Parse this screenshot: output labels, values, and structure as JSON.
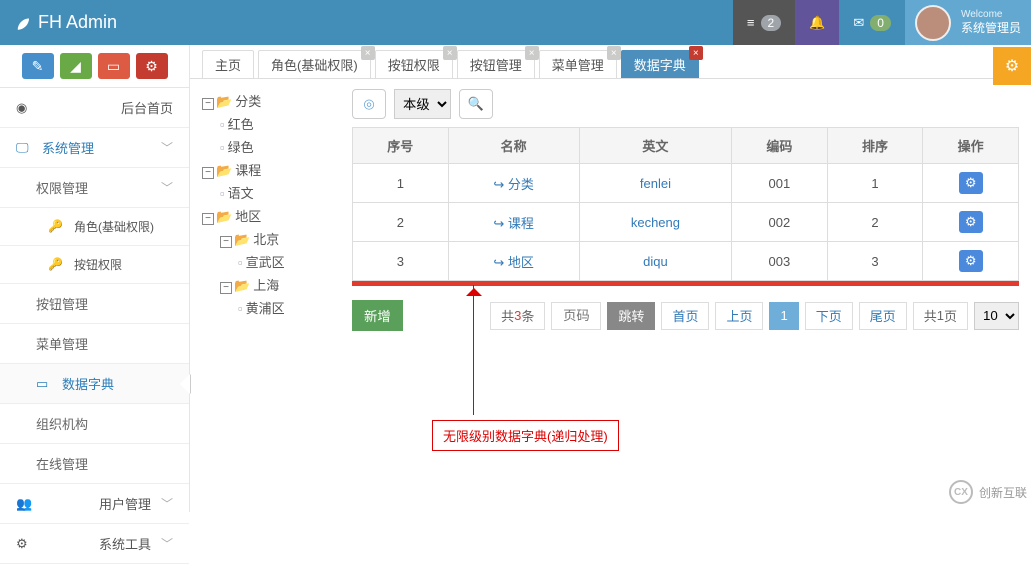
{
  "header": {
    "brand": "FH Admin",
    "tasks_badge": "2",
    "mail_badge": "0",
    "welcome": "Welcome",
    "username": "系统管理员"
  },
  "mini_buttons": [
    "pencil",
    "chart",
    "book",
    "gear"
  ],
  "sidebar": {
    "items": [
      {
        "label": "后台首页"
      },
      {
        "label": "系统管理"
      },
      {
        "label": "权限管理"
      },
      {
        "label": "角色(基础权限)"
      },
      {
        "label": "按钮权限"
      },
      {
        "label": "按钮管理"
      },
      {
        "label": "菜单管理"
      },
      {
        "label": "数据字典"
      },
      {
        "label": "组织机构"
      },
      {
        "label": "在线管理"
      },
      {
        "label": "用户管理"
      },
      {
        "label": "系统工具"
      }
    ]
  },
  "tabs": [
    {
      "label": "主页",
      "closable": false
    },
    {
      "label": "角色(基础权限)",
      "closable": true
    },
    {
      "label": "按钮权限",
      "closable": true
    },
    {
      "label": "按钮管理",
      "closable": true
    },
    {
      "label": "菜单管理",
      "closable": true
    },
    {
      "label": "数据字典",
      "closable": true,
      "active": true
    }
  ],
  "tree": [
    {
      "d": 0,
      "t": "minus",
      "f": "folder",
      "label": "分类"
    },
    {
      "d": 1,
      "t": "",
      "f": "file",
      "label": "红色"
    },
    {
      "d": 1,
      "t": "",
      "f": "file",
      "label": "绿色"
    },
    {
      "d": 0,
      "t": "minus",
      "f": "folder",
      "label": "课程"
    },
    {
      "d": 1,
      "t": "",
      "f": "file",
      "label": "语文"
    },
    {
      "d": 0,
      "t": "minus",
      "f": "folder",
      "label": "地区"
    },
    {
      "d": 1,
      "t": "minus",
      "f": "folder",
      "label": "北京"
    },
    {
      "d": 2,
      "t": "",
      "f": "file",
      "label": "宣武区"
    },
    {
      "d": 1,
      "t": "minus",
      "f": "folder",
      "label": "上海"
    },
    {
      "d": 2,
      "t": "",
      "f": "file",
      "label": "黄浦区"
    }
  ],
  "level_select": "本级",
  "columns": {
    "idx": "序号",
    "name": "名称",
    "en": "英文",
    "code": "编码",
    "sort": "排序",
    "op": "操作"
  },
  "rows": [
    {
      "idx": "1",
      "name": "分类",
      "en": "fenlei",
      "code": "001",
      "sort": "1"
    },
    {
      "idx": "2",
      "name": "课程",
      "en": "kecheng",
      "code": "002",
      "sort": "2"
    },
    {
      "idx": "3",
      "name": "地区",
      "en": "diqu",
      "code": "003",
      "sort": "3"
    }
  ],
  "new_btn": "新增",
  "pager": {
    "total_prefix": "共",
    "total_count": "3",
    "total_suffix": "条",
    "page_placeholder": "页码",
    "jump": "跳转",
    "first": "首页",
    "prev": "上页",
    "num": "1",
    "next": "下页",
    "last": "尾页",
    "pages_prefix": "共",
    "pages_count": "1",
    "pages_suffix": "页",
    "size": "10"
  },
  "annotation": "无限级别数据字典(递归处理)",
  "watermark": "创新互联"
}
